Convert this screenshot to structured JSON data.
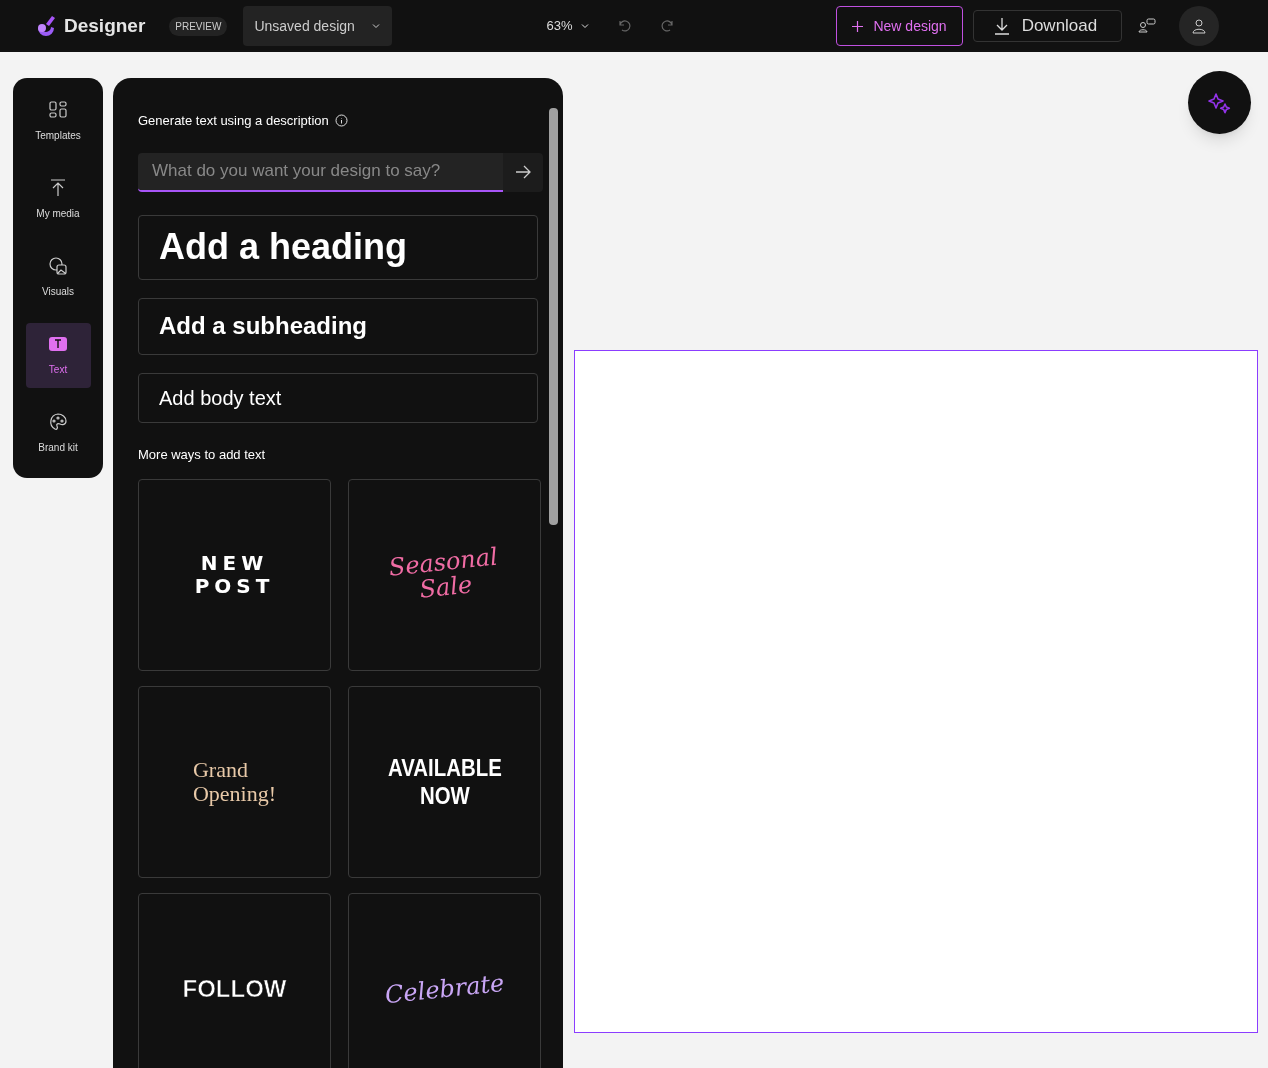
{
  "app": {
    "name": "Designer",
    "badge": "PREVIEW"
  },
  "design_menu": {
    "label": "Unsaved design"
  },
  "zoom": {
    "value": "63%"
  },
  "actions": [
    {
      "label": "New design",
      "kind": "primary"
    },
    {
      "label": "Download",
      "kind": "download"
    }
  ],
  "rail": [
    {
      "label": "Templates",
      "kind": "templates",
      "selected": false
    },
    {
      "label": "My media",
      "kind": "media",
      "selected": false
    },
    {
      "label": "Visuals",
      "kind": "visuals",
      "selected": false
    },
    {
      "label": "Text",
      "kind": "text",
      "selected": true
    },
    {
      "label": "Brand kit",
      "kind": "brand",
      "selected": false
    }
  ],
  "panel": {
    "generate_label": "Generate text using a description",
    "prompt": {
      "placeholder": "What do you want your design to say?"
    },
    "styles": [
      {
        "label": "Add a heading",
        "kind": "heading"
      },
      {
        "label": "Add a subheading",
        "kind": "subheading"
      },
      {
        "label": "Add body text",
        "kind": "body"
      }
    ],
    "more_label": "More ways to add text",
    "tiles": [
      {
        "lines": [
          "NEW",
          "POST"
        ],
        "kind": "spaced",
        "color": "#ffffff"
      },
      {
        "lines": [
          "Seasonal",
          "Sale"
        ],
        "kind": "script",
        "color": "#f06ca4"
      },
      {
        "lines": [
          "Grand",
          "Opening!"
        ],
        "kind": "serif",
        "color": "#e8c9a8"
      },
      {
        "lines": [
          "AVAILABLE",
          "NOW"
        ],
        "kind": "condensed",
        "color": "#ffffff"
      },
      {
        "lines": [
          "FOLLOW"
        ],
        "kind": "outline",
        "color": "#ffffff"
      },
      {
        "lines": [
          "Celebrate"
        ],
        "kind": "script",
        "color": "#c9a6f5"
      }
    ]
  }
}
